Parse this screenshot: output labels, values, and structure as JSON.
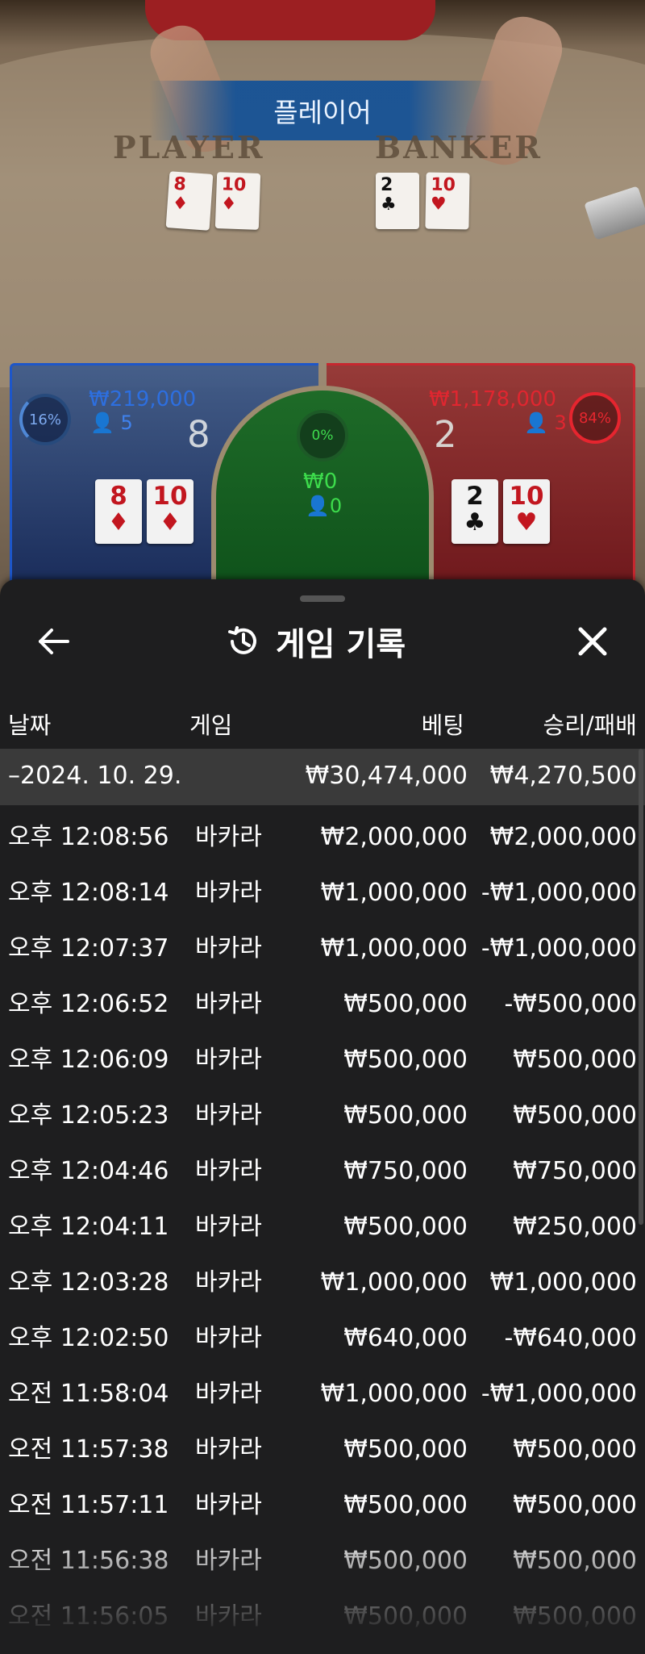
{
  "live_table": {
    "winner_banner": "플레이어",
    "player_label": "PLAYER",
    "banker_label": "BANKER",
    "player_cards": [
      {
        "rank": "8",
        "suit": "♦",
        "color": "red"
      },
      {
        "rank": "10",
        "suit": "♦",
        "color": "red"
      }
    ],
    "banker_cards": [
      {
        "rank": "2",
        "suit": "♣",
        "color": "black"
      },
      {
        "rank": "10",
        "suit": "♥",
        "color": "red"
      }
    ]
  },
  "bets": {
    "player": {
      "percent": "16%",
      "amount": "₩219,000",
      "count": "5",
      "score": "8"
    },
    "tie": {
      "percent": "0%",
      "amount": "₩0",
      "count": "0"
    },
    "banker": {
      "percent": "84%",
      "amount": "₩1,178,000",
      "count": "3",
      "score": "2"
    }
  },
  "history": {
    "title": "게임 기록",
    "columns": {
      "date": "날짜",
      "game": "게임",
      "bet": "베팅",
      "result": "승리/패배"
    },
    "summary": {
      "date": "–2024. 10. 29.",
      "bet": "₩30,474,000",
      "result": "₩4,270,500"
    },
    "rows": [
      {
        "time": "오후 12:08:56",
        "game": "바카라",
        "bet": "₩2,000,000",
        "result": "₩2,000,000"
      },
      {
        "time": "오후 12:08:14",
        "game": "바카라",
        "bet": "₩1,000,000",
        "result": "-₩1,000,000"
      },
      {
        "time": "오후 12:07:37",
        "game": "바카라",
        "bet": "₩1,000,000",
        "result": "-₩1,000,000"
      },
      {
        "time": "오후 12:06:52",
        "game": "바카라",
        "bet": "₩500,000",
        "result": "-₩500,000"
      },
      {
        "time": "오후 12:06:09",
        "game": "바카라",
        "bet": "₩500,000",
        "result": "₩500,000"
      },
      {
        "time": "오후 12:05:23",
        "game": "바카라",
        "bet": "₩500,000",
        "result": "₩500,000"
      },
      {
        "time": "오후 12:04:46",
        "game": "바카라",
        "bet": "₩750,000",
        "result": "₩750,000"
      },
      {
        "time": "오후 12:04:11",
        "game": "바카라",
        "bet": "₩500,000",
        "result": "₩250,000"
      },
      {
        "time": "오후 12:03:28",
        "game": "바카라",
        "bet": "₩1,000,000",
        "result": "₩1,000,000"
      },
      {
        "time": "오후 12:02:50",
        "game": "바카라",
        "bet": "₩640,000",
        "result": "-₩640,000"
      },
      {
        "time": "오전 11:58:04",
        "game": "바카라",
        "bet": "₩1,000,000",
        "result": "-₩1,000,000"
      },
      {
        "time": "오전 11:57:38",
        "game": "바카라",
        "bet": "₩500,000",
        "result": "₩500,000"
      },
      {
        "time": "오전 11:57:11",
        "game": "바카라",
        "bet": "₩500,000",
        "result": "₩500,000"
      },
      {
        "time": "오전 11:56:38",
        "game": "바카라",
        "bet": "₩500,000",
        "result": "₩500,000"
      },
      {
        "time": "오전 11:56:05",
        "game": "바카라",
        "bet": "₩500,000",
        "result": "₩500,000"
      }
    ]
  }
}
